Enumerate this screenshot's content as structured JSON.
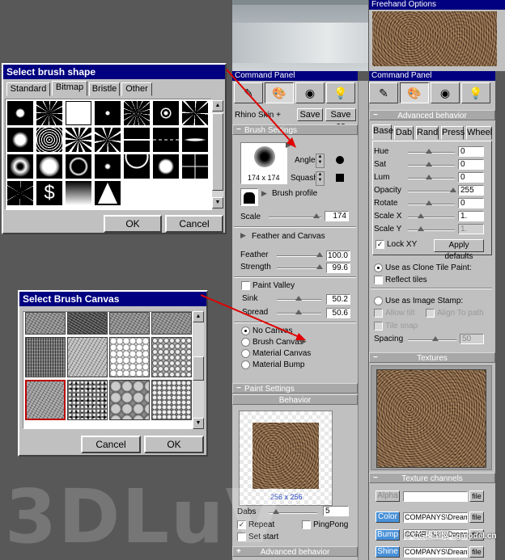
{
  "freehand_options": {
    "title": "Freehand Options"
  },
  "command_panel": {
    "title": "Command Panel",
    "skin_label": "Rhino Skin +",
    "save_label": "Save",
    "save_as_label": "Save as",
    "brush_settings": "Brush Settings",
    "angle_label": "Angle",
    "squash_label": "Squash",
    "size_label": "174 x 174",
    "brush_profile": "Brush profile",
    "scale_label": "Scale",
    "scale_value": "174",
    "feather_and_canvas": "Feather and Canvas",
    "feather_label": "Feather",
    "feather_value": "100.0",
    "strength_label": "Strength",
    "strength_value": "99.6",
    "paint_valley": "Paint Valley",
    "sink_label": "Sink",
    "sink_value": "50.2",
    "spread_label": "Spread",
    "spread_value": "50.6",
    "canvas_options": [
      "No Canvas",
      "Brush Canvas",
      "Material Canvas",
      "Material Bump"
    ],
    "paint_settings": "Paint Settings",
    "behavior": "Behavior",
    "texture_size": "256 x 256",
    "dabs_label": "Dabs",
    "dabs_value": "5",
    "repeat_label": "Repeat",
    "pingpong_label": "PingPong",
    "setstart_label": "Set start",
    "advanced_behavior_footer": "Advanced behavior"
  },
  "command_panel_right": {
    "title": "Command Panel",
    "advanced_behavior": "Advanced behavior",
    "tabs": [
      "Base",
      "Dab",
      "Rand",
      "Press",
      "Wheel"
    ],
    "rows": [
      {
        "label": "Hue",
        "value": "0"
      },
      {
        "label": "Sat",
        "value": "0"
      },
      {
        "label": "Lum",
        "value": "0"
      },
      {
        "label": "Opacity",
        "value": "255"
      },
      {
        "label": "Rotate",
        "value": "0"
      },
      {
        "label": "Scale X",
        "value": "1."
      },
      {
        "label": "Scale Y",
        "value": "1."
      }
    ],
    "lock_xy": "Lock XY",
    "apply_defaults": "Apply defaults",
    "clone_tile": "Use as Clone Tile Paint:",
    "reflect_tiles": "Reflect tiles",
    "image_stamp": "Use as Image Stamp:",
    "allow_tilt": "Allow tilt",
    "align_to_path": "Align To path",
    "tile_snap": "Tile snap",
    "spacing_label": "Spacing",
    "spacing_value": "50",
    "textures": "Textures",
    "texture_channels": "Texture channels",
    "alpha_label": "Alpha",
    "color_label": "Color",
    "bump_label": "Bump",
    "shine_label": "Shine",
    "file_label": "file",
    "color_path": "COMPANYS\\Dream",
    "bump_path": "COMPANYS\\Dream",
    "shine_path": "COMPANYS\\Dream"
  },
  "brush_shape_dialog": {
    "title": "Select brush shape",
    "tabs": [
      "Standard",
      "Bitmap",
      "Bristle",
      "Other"
    ],
    "active_tab": "Bitmap",
    "ok_label": "OK",
    "cancel_label": "Cancel"
  },
  "brush_canvas_dialog": {
    "title": "Select Brush Canvas",
    "ok_label": "OK",
    "cancel_label": "Cancel"
  },
  "watermark": {
    "text": "3DLuV",
    "site_text": "© CG模型网 cgmodel.cn"
  },
  "colors": {
    "title_blue": "#000080",
    "dialog_gray": "#c0c0c0",
    "arrow_red": "#e00000"
  }
}
